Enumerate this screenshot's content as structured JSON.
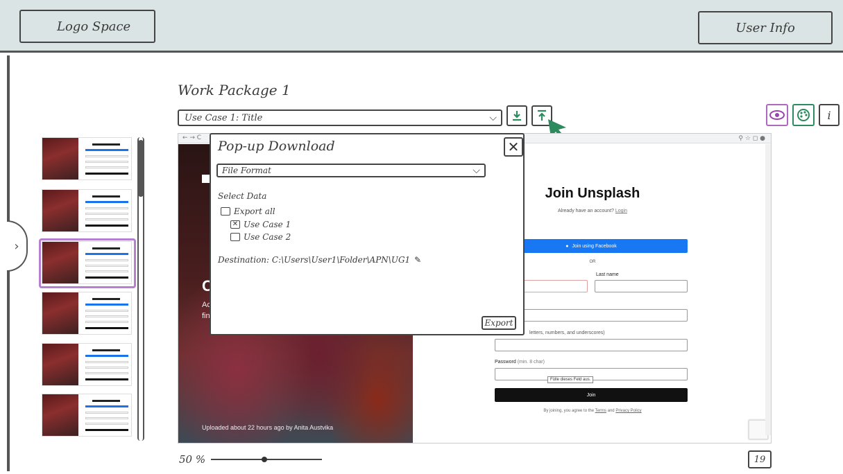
{
  "header": {
    "logo_text": "Logo Space",
    "user_info_text": "User Info"
  },
  "sidebar": {
    "toggle_glyph": "›"
  },
  "workpackage": {
    "title": "Work Package 1",
    "use_case_selected": "Use Case 1: Title",
    "download_icon": "download-icon",
    "upload_icon": "upload-icon"
  },
  "toolbar": {
    "preview_icon": "eye-icon",
    "theme_icon": "palette-icon",
    "info_label": "i"
  },
  "thumbnails": {
    "count": 6,
    "selected_index": 2
  },
  "preview": {
    "browser_nav": "← → C",
    "photo": {
      "heading_initial": "C",
      "sub1": "Ac",
      "sub2": "fin",
      "credit": "Uploaded about 22 hours ago by Anita Austvika"
    },
    "form": {
      "title": "Join Unsplash",
      "have_account": "Already have an account?",
      "login_link": "Login",
      "facebook_button": "Join using Facebook",
      "or_text": "OR",
      "last_name_label": "Last name",
      "username_hint": "letters, numbers, and underscores)",
      "password_label": "Password",
      "password_hint": "(min. 8 char)",
      "tooltip": "Fülle dieses Feld aus.",
      "join_button": "Join",
      "terms_prefix": "By joining, you agree to the",
      "terms_link": "Terms",
      "terms_and": "and",
      "privacy_link": "Privacy Policy"
    }
  },
  "popup": {
    "title": "Pop-up Download",
    "close_glyph": "✕",
    "file_format_label": "File Format",
    "select_data_label": "Select Data",
    "options": [
      {
        "label": "Export all",
        "checked": false
      },
      {
        "label": "Use Case 1",
        "checked": true
      },
      {
        "label": "Use Case 2",
        "checked": false
      }
    ],
    "destination": "Destination: C:\\Users\\User1\\Folder\\APN\\UG1",
    "export_button": "Export"
  },
  "footer": {
    "zoom_label": "50 %",
    "zoom_level_percent": 50,
    "page_number": "19"
  },
  "colors": {
    "accent_green": "#2c8a5e",
    "accent_purple": "#b067c2",
    "facebook_blue": "#1877f2"
  }
}
